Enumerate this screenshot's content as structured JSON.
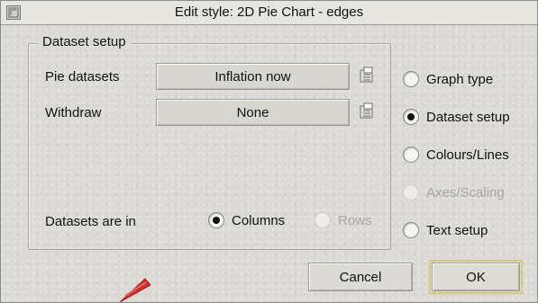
{
  "window": {
    "title": "Edit style: 2D Pie Chart - edges"
  },
  "dataset_setup": {
    "group_title": "Dataset setup",
    "pie_datasets": {
      "label": "Pie datasets",
      "value": "Inflation now"
    },
    "withdraw": {
      "label": "Withdraw",
      "value": "None"
    },
    "datasets_are_in": {
      "label": "Datasets are in",
      "options": [
        {
          "label": "Columns",
          "selected": true,
          "enabled": true
        },
        {
          "label": "Rows",
          "selected": false,
          "enabled": false
        }
      ]
    }
  },
  "sections": [
    {
      "label": "Graph type",
      "selected": false,
      "enabled": true
    },
    {
      "label": "Dataset setup",
      "selected": true,
      "enabled": true
    },
    {
      "label": "Colours/Lines",
      "selected": false,
      "enabled": true
    },
    {
      "label": "Axes/Scaling",
      "selected": false,
      "enabled": false
    },
    {
      "label": "Text setup",
      "selected": false,
      "enabled": true
    }
  ],
  "buttons": {
    "cancel": "Cancel",
    "ok": "OK"
  },
  "colors": {
    "window_bg": "#dcdad4",
    "titlebar_bg": "#e6e5df",
    "pointer": "#cc2f2f",
    "disabled_text": "#a8a7a2"
  },
  "icons": {
    "window": "window-icon",
    "menu": "menu-icon",
    "pointer": "pointer-icon"
  }
}
